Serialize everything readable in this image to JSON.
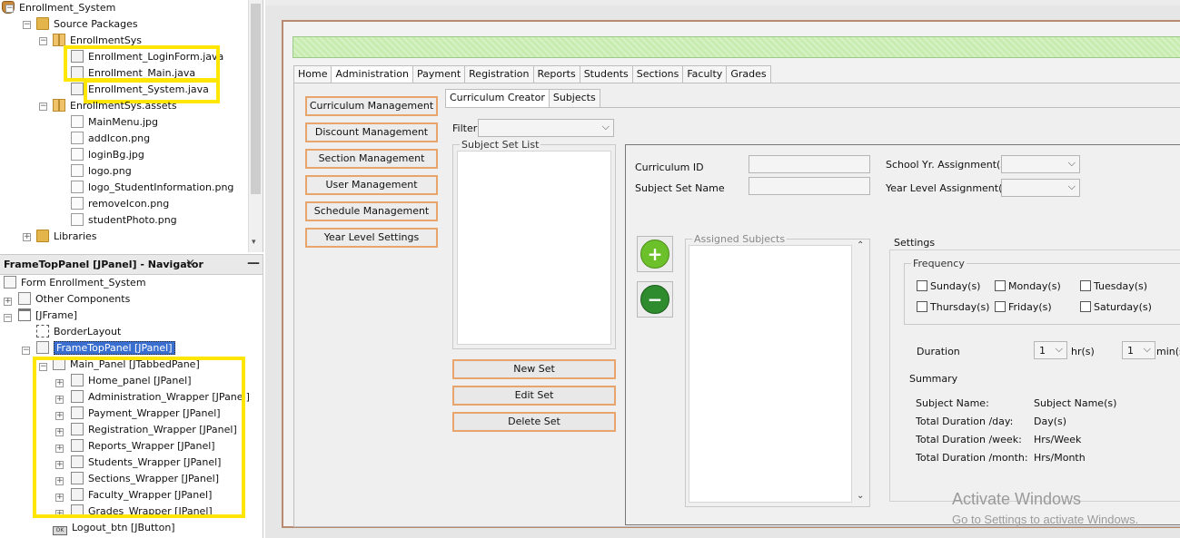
{
  "project_tree": {
    "root": "Enrollment_System",
    "source_packages": "Source Packages",
    "package1": "EnrollmentSys",
    "files1": [
      "Enrollment_LoginForm.java",
      "Enrollment_Main.java",
      "Enrollment_System.java"
    ],
    "package2": "EnrollmentSys.assets",
    "files2": [
      "MainMenu.jpg",
      "addIcon.png",
      "loginBg.jpg",
      "logo.png",
      "logo_StudentInformation.png",
      "removeIcon.png",
      "studentPhoto.png"
    ],
    "libraries": "Libraries"
  },
  "navigator": {
    "title": "FrameTopPanel [JPanel] - Navigator",
    "close_icon": "×",
    "minimize_icon": "—",
    "form_label": "Form Enrollment_System",
    "other_components": "Other Components",
    "jframe": "[JFrame]",
    "border_layout": "BorderLayout",
    "frame_top_panel": "FrameTopPanel [JPanel]",
    "main_panel": "Main_Panel [JTabbedPane]",
    "children": [
      "Home_panel [JPanel]",
      "Administration_Wrapper [JPanel]",
      "Payment_Wrapper [JPanel]",
      "Registration_Wrapper [JPanel]",
      "Reports_Wrapper [JPanel]",
      "Students_Wrapper [JPanel]",
      "Sections_Wrapper [JPanel]",
      "Faculty_Wrapper [JPanel]",
      "Grades_Wrapper [JPanel]"
    ],
    "logout": "Logout_btn [JButton]"
  },
  "main_tabs": [
    "Home",
    "Administration",
    "Payment",
    "Registration",
    "Reports",
    "Students",
    "Sections",
    "Faculty",
    "Grades"
  ],
  "side_buttons": [
    "Curriculum Management",
    "Discount Management",
    "Section Management",
    "User Management",
    "Schedule Management",
    "Year Level Settings"
  ],
  "sub_tabs": [
    "Curriculum Creator",
    "Subjects"
  ],
  "curriculum": {
    "filter_label": "Filter",
    "subject_set_list": "Subject Set List",
    "new_set": "New Set",
    "edit_set": "Edit Set",
    "delete_set": "Delete Set",
    "curriculum_id_label": "Curriculum ID",
    "subject_set_name_label": "Subject Set Name",
    "school_yr_label": "School Yr. Assignment(s)",
    "year_level_label": "Year Level Assignment(s)",
    "assigned_subjects": "Assigned Subjects",
    "add_icon": "+",
    "remove_icon": "−"
  },
  "settings": {
    "title": "Settings",
    "frequency": "Frequency",
    "days": [
      "Sunday(s)",
      "Monday(s)",
      "Tuesday(s)",
      "Thursday(s)",
      "Friday(s)",
      "Saturday(s)"
    ],
    "duration_label": "Duration",
    "hours_value": "1",
    "hours_unit": "hr(s)",
    "minutes_value": "1",
    "minutes_unit": "min(s",
    "summary": "Summary",
    "summary_labels": [
      "Subject Name:",
      "Total Duration /day:",
      "Total Duration /week:",
      "Total Duration /month:"
    ],
    "summary_values": [
      "Subject Name(s)",
      "Day(s)",
      "Hrs/Week",
      "Hrs/Month"
    ]
  },
  "watermark": {
    "line1": "Activate Windows",
    "line2": "Go to Settings to activate Windows."
  }
}
